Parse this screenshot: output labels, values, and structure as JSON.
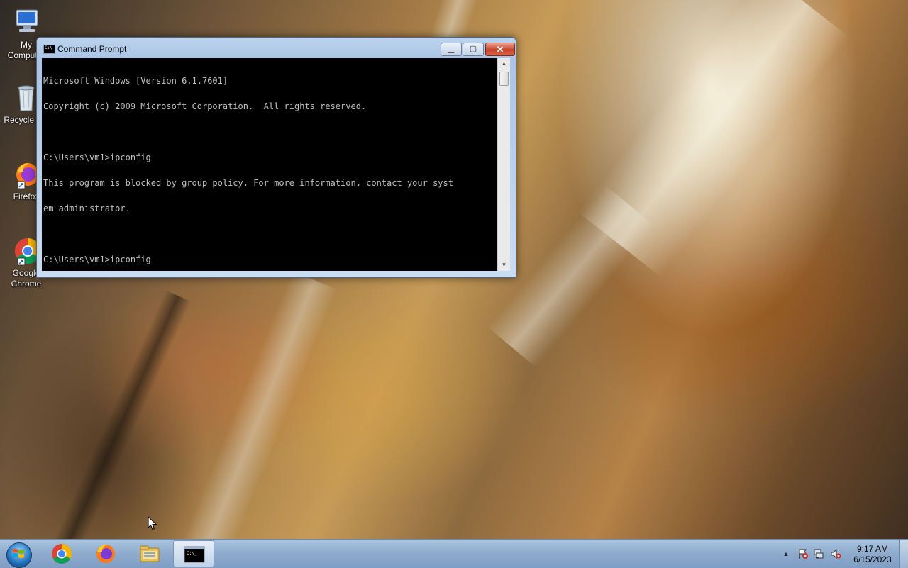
{
  "desktop": {
    "icons": [
      {
        "label_line1": "My",
        "label_line2": "Computer",
        "icon": "computer-icon"
      },
      {
        "label_line1": "Recycle Bin",
        "icon": "recycle-bin-icon"
      },
      {
        "label_line1": "Firefox",
        "icon": "firefox-icon"
      },
      {
        "label_line1": "Google",
        "label_line2": "Chrome",
        "icon": "chrome-icon"
      }
    ]
  },
  "window": {
    "title": "Command Prompt",
    "icon": "cmd-icon",
    "controls": {
      "minimize": "minimize-icon",
      "maximize": "maximize-icon",
      "close": "close-icon"
    },
    "console_lines": [
      "Microsoft Windows [Version 6.1.7601]",
      "Copyright (c) 2009 Microsoft Corporation.  All rights reserved.",
      "",
      "C:\\Users\\vm1>ipconfig",
      "This program is blocked by group policy. For more information, contact your syst",
      "em administrator.",
      "",
      "C:\\Users\\vm1>ipconfig"
    ]
  },
  "taskbar": {
    "start_icon": "windows-start-icon",
    "pinned": [
      {
        "name": "chrome",
        "icon": "chrome-icon",
        "active": false
      },
      {
        "name": "firefox",
        "icon": "firefox-icon",
        "active": false
      },
      {
        "name": "explorer",
        "icon": "folder-icon",
        "active": false
      },
      {
        "name": "cmd",
        "icon": "cmd-icon",
        "active": true
      }
    ],
    "tray_icons": [
      "show-hidden-icons-icon",
      "action-center-flag-icon",
      "network-icon",
      "volume-muted-icon"
    ],
    "clock": {
      "time": "9:17 AM",
      "date": "6/15/2023"
    }
  },
  "colors": {
    "console_bg": "#000000",
    "console_fg": "#c0c0c0",
    "close_button": "#c8432a",
    "taskbar": "#8eabcd"
  }
}
